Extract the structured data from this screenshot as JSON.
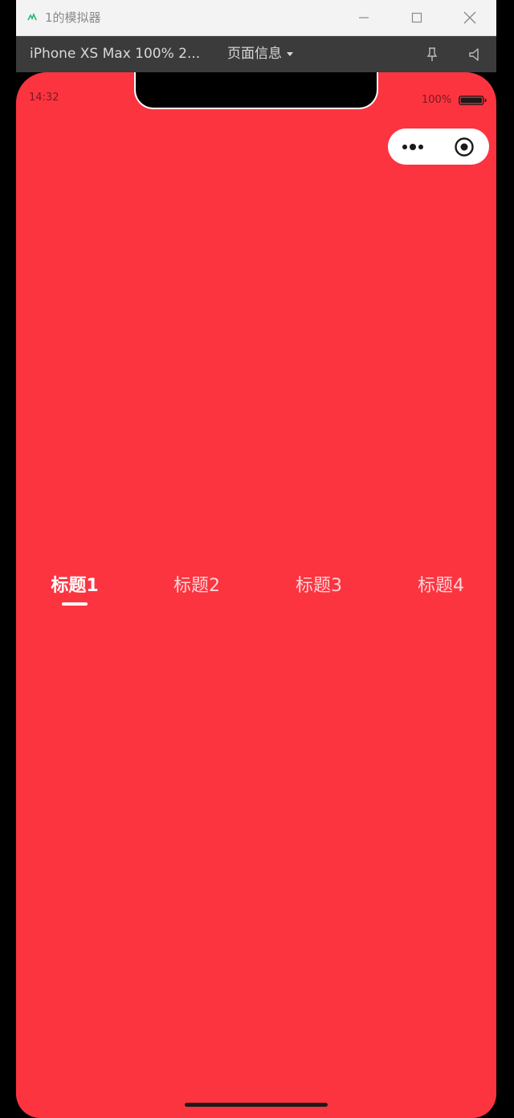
{
  "window": {
    "title": "1的模拟器",
    "minimize_icon": "minimize-icon",
    "maximize_icon": "maximize-icon",
    "close_icon": "close-icon"
  },
  "toolbar": {
    "device_label": "iPhone XS Max 100% 2...",
    "page_info_label": "页面信息",
    "pin_icon": "pin-icon",
    "volume_icon": "volume-icon"
  },
  "status_bar": {
    "time": "14:32",
    "battery_percent": "100%",
    "battery_level": 1.0
  },
  "capsule": {
    "more_icon": "more-dots-icon",
    "close_icon": "target-circle-icon"
  },
  "tabs": {
    "active_index": 0,
    "items": [
      {
        "label": "标题1"
      },
      {
        "label": "标题2"
      },
      {
        "label": "标题3"
      },
      {
        "label": "标题4"
      }
    ]
  },
  "colors": {
    "screen_background": "#fc3440",
    "tab_active": "#ffffff",
    "tab_inactive": "#ffd4d7",
    "toolbar": "#3b3b3b",
    "titlebar": "#f3f3f3"
  }
}
